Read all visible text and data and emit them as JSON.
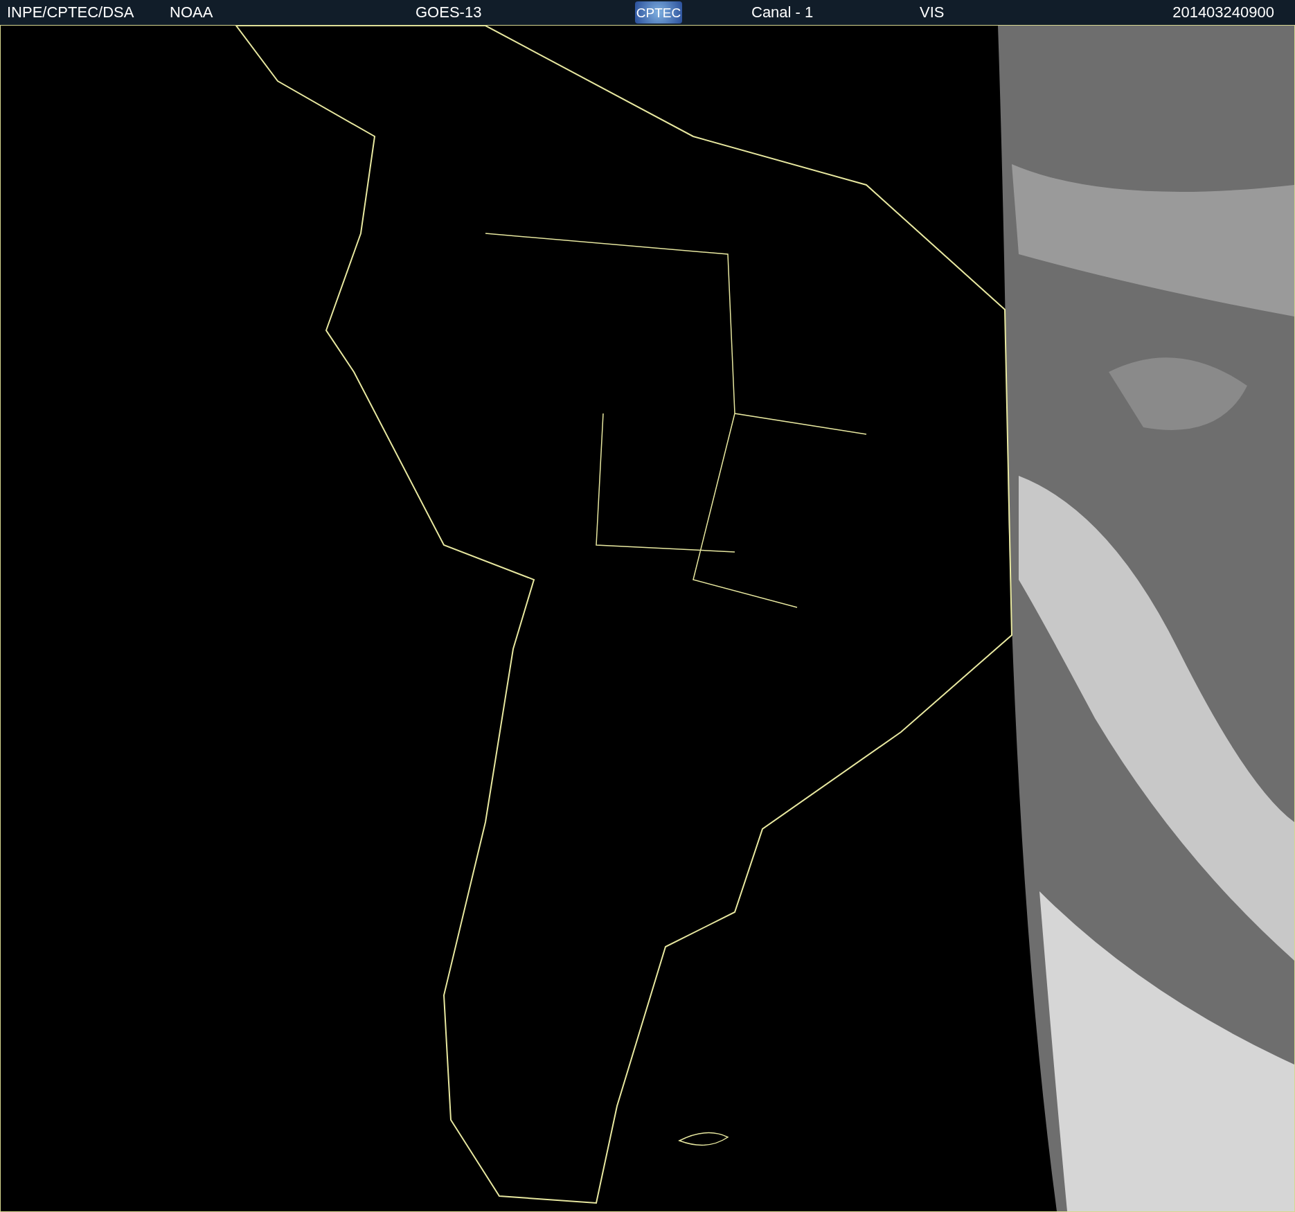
{
  "header": {
    "source": "INPE/CPTEC/DSA",
    "agency": "NOAA",
    "satellite": "GOES-13",
    "logo": "CPTEC",
    "channel": "Canal - 1",
    "band": "VIS",
    "timestamp": "201403240900"
  }
}
